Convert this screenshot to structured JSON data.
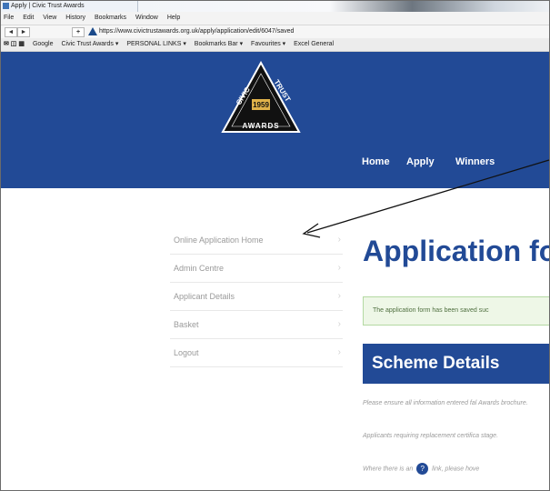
{
  "browser": {
    "tab_title": "Apply | Civic Trust Awards",
    "menu": [
      "File",
      "Edit",
      "View",
      "History",
      "Bookmarks",
      "Window",
      "Help"
    ],
    "back_glyph": "◄",
    "forward_glyph": "►",
    "new_tab_glyph": "+",
    "url": "https://www.civictrustawards.org.uk/apply/application/edit/6047/saved",
    "bookmarks": [
      "Google",
      "Civic Trust Awards ▾",
      "PERSONAL LINKS ▾",
      "Bookmarks Bar ▾",
      "Favourites ▾",
      "Excel General"
    ]
  },
  "site": {
    "brand_color": "#224a96",
    "logo": {
      "words_top_left": "CIVIC",
      "words_top_right": "TRUST",
      "year": "1959",
      "bottom": "AWARDS"
    },
    "nav": [
      "Home",
      "Apply",
      "Winners"
    ]
  },
  "sidebar": {
    "items": [
      {
        "label": "Online Application Home"
      },
      {
        "label": "Admin Centre"
      },
      {
        "label": "Applicant Details"
      },
      {
        "label": "Basket"
      },
      {
        "label": "Logout"
      }
    ],
    "chevron": "›"
  },
  "main": {
    "title": "Application fo",
    "notice": "The application form has been saved suc",
    "section_title": "Scheme Details",
    "para1": "Please ensure all information entered fal Awards brochure.",
    "para2": "Applicants requiring replacement certifica stage.",
    "para3_before": "Where there is an",
    "para3_icon": "?",
    "para3_after": "link, please hove"
  }
}
